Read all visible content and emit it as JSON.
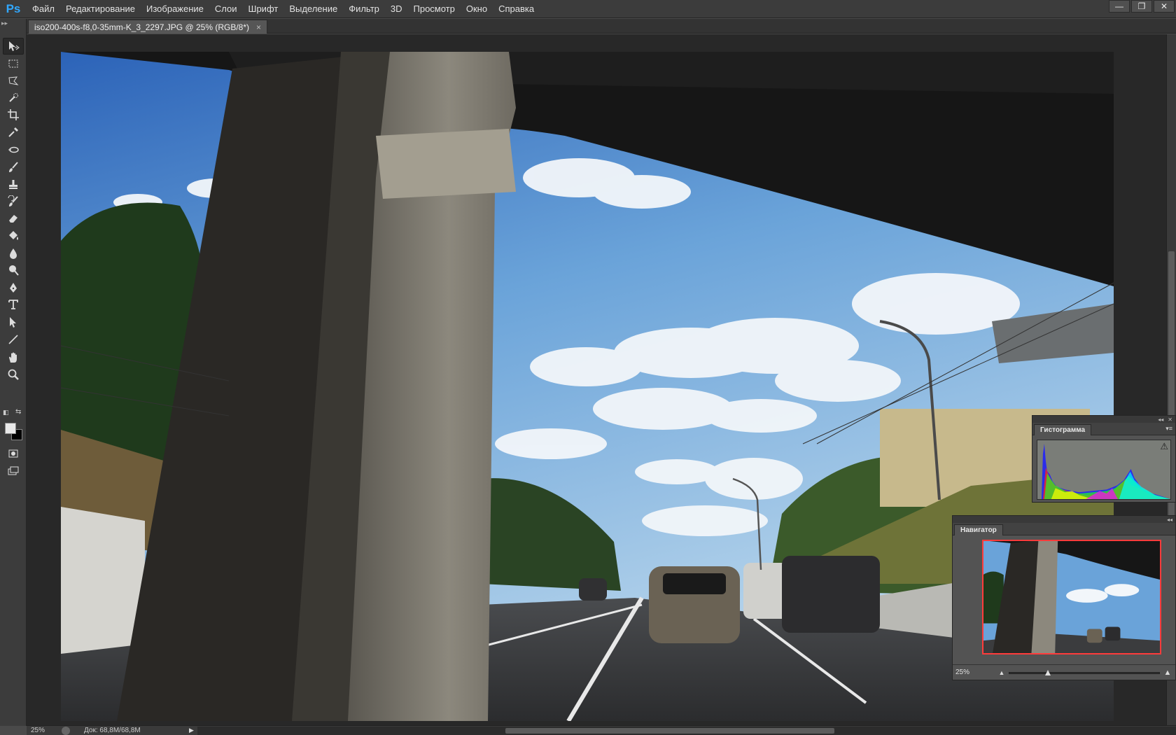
{
  "app": {
    "logo": "Ps",
    "menu": [
      "Файл",
      "Редактирование",
      "Изображение",
      "Слои",
      "Шрифт",
      "Выделение",
      "Фильтр",
      "3D",
      "Просмотр",
      "Окно",
      "Справка"
    ],
    "window_controls": {
      "minimize": "—",
      "restore": "❐",
      "close": "✕"
    }
  },
  "document": {
    "tab_title": "iso200-400s-f8,0-35mm-K_3_2297.JPG @ 25% (RGB/8*)",
    "tab_close": "×"
  },
  "status": {
    "zoom": "25%",
    "doc_size": "Док: 68,8M/68,8M",
    "arrow": "▶"
  },
  "panels": {
    "histogram": {
      "tab": "Гистограмма",
      "warning": "⚠"
    },
    "navigator": {
      "tab": "Навигатор",
      "zoom": "25%",
      "zoom_out": "▲",
      "zoom_in": "▲",
      "slider_position": 0.26
    }
  },
  "toolbar": {
    "tools": [
      "move-tool",
      "marquee-tool",
      "lasso-tool",
      "quick-selection-tool",
      "crop-tool",
      "eyedropper-tool",
      "spot-healing-tool",
      "brush-tool",
      "clone-stamp-tool",
      "history-brush-tool",
      "eraser-tool",
      "paint-bucket-tool",
      "blur-tool",
      "dodge-tool",
      "pen-tool",
      "type-tool",
      "path-selection-tool",
      "line-tool",
      "hand-tool",
      "zoom-tool"
    ],
    "foreground_color": "#e9e9e9",
    "background_color": "#000000"
  },
  "colors": {
    "accent": "#31a8ff",
    "navigator_frame": "#ff3b3b"
  }
}
